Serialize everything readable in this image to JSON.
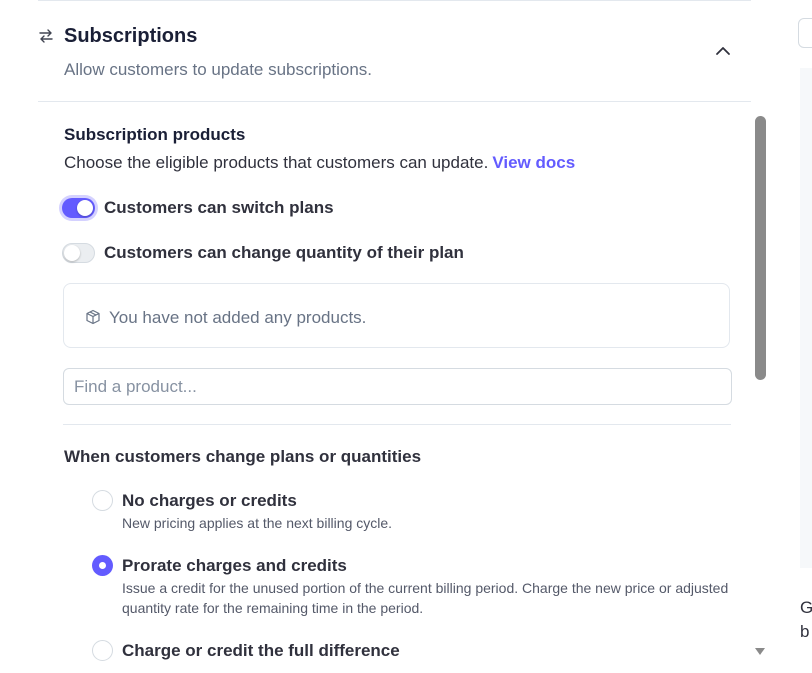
{
  "section": {
    "title": "Subscriptions",
    "description": "Allow customers to update subscriptions."
  },
  "products": {
    "title": "Subscription products",
    "description": "Choose the eligible products that customers can update.",
    "link_label": "View docs",
    "toggle_switch_plans": {
      "label": "Customers can switch plans",
      "on": true
    },
    "toggle_change_quantity": {
      "label": "Customers can change quantity of their plan",
      "on": false
    },
    "empty_message": "You have not added any products.",
    "search_placeholder": "Find a product..."
  },
  "proration": {
    "title": "When customers change plans or quantities",
    "options": [
      {
        "label": "No charges or credits",
        "description": "New pricing applies at the next billing cycle.",
        "selected": false
      },
      {
        "label": "Prorate charges and credits",
        "description": "Issue a credit for the unused portion of the current billing period. Charge the new price or adjusted quantity rate for the remaining time in the period.",
        "selected": true
      },
      {
        "label": "Charge or credit the full difference",
        "description": "",
        "selected": false
      }
    ]
  },
  "right_panel": {
    "line1": "G",
    "line2": "b"
  },
  "colors": {
    "accent": "#635bff",
    "text": "#30313d",
    "muted": "#687385",
    "border": "#e3e8ee"
  }
}
